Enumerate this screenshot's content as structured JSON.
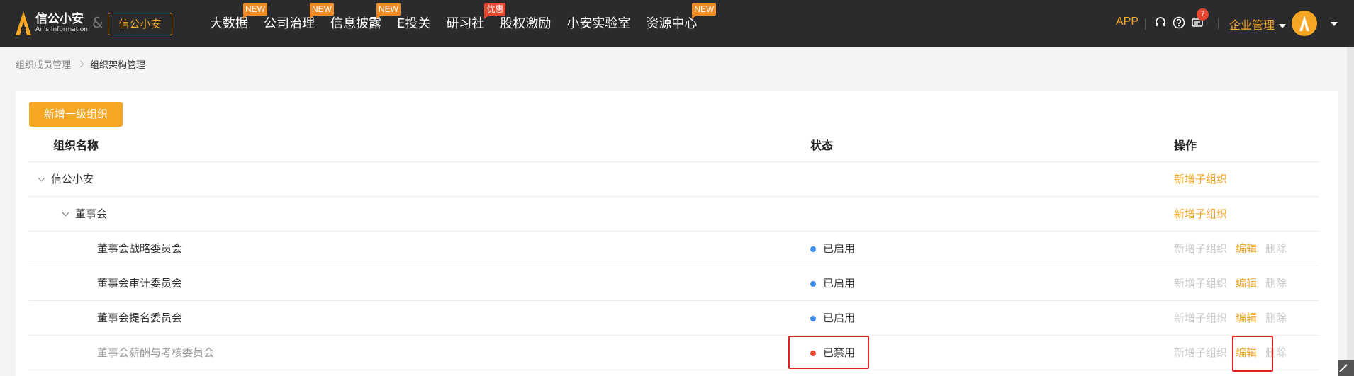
{
  "brand": {
    "name_cn": "信公小安",
    "name_en": "An's Information",
    "amp": "&",
    "org_label": "信公小安",
    "accent": "#f5a623"
  },
  "nav": {
    "items": [
      {
        "label": "大数据",
        "badge": "NEW"
      },
      {
        "label": "公司治理",
        "badge": "NEW"
      },
      {
        "label": "信息披露",
        "badge": "NEW"
      },
      {
        "label": "E投关",
        "badge": ""
      },
      {
        "label": "研习社",
        "badge": "优惠"
      },
      {
        "label": "股权激励",
        "badge": ""
      },
      {
        "label": "小安实验室",
        "badge": ""
      },
      {
        "label": "资源中心",
        "badge": "NEW"
      }
    ]
  },
  "tools": {
    "app_label": "APP",
    "headset_icon": "headset-icon",
    "help_icon": "help-icon",
    "message_icon": "message-icon",
    "message_count": "7",
    "enterprise_label": "企业管理"
  },
  "breadcrumb": {
    "parent": "组织成员管理",
    "current": "组织架构管理"
  },
  "toolbar": {
    "add_label": "新增一级组织"
  },
  "table": {
    "headers": {
      "name": "组织名称",
      "status": "状态",
      "ops": "操作"
    },
    "rows": [
      {
        "name": "信公小安",
        "status": "",
        "ops": [
          "新增子组织"
        ]
      },
      {
        "name": "董事会",
        "status": "",
        "ops": [
          "新增子组织"
        ]
      },
      {
        "name": "董事会战略委员会",
        "status": "已启用",
        "ops": [
          "新增子组织",
          "编辑",
          "删除"
        ]
      },
      {
        "name": "董事会审计委员会",
        "status": "已启用",
        "ops": [
          "新增子组织",
          "编辑",
          "删除"
        ]
      },
      {
        "name": "董事会提名委员会",
        "status": "已启用",
        "ops": [
          "新增子组织",
          "编辑",
          "删除"
        ]
      },
      {
        "name": "董事会薪酬与考核委员会",
        "status": "已禁用",
        "ops": [
          "新增子组织",
          "编辑",
          "删除"
        ]
      }
    ]
  },
  "colors": {
    "enabled_dot": "#3d8ef0",
    "disabled_dot": "#e8452e",
    "highlight": "#e02020"
  }
}
